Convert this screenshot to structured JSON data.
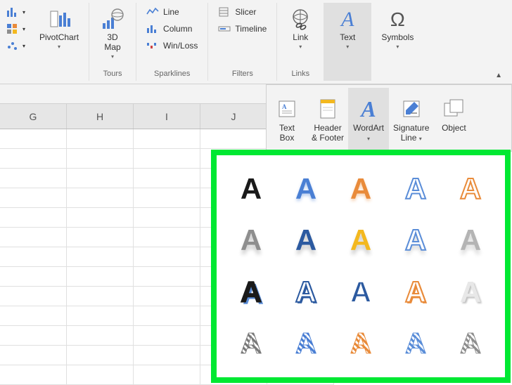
{
  "ribbon": {
    "charts": {
      "group_label": ""
    },
    "pivotchart_label": "PivotChart",
    "tours": {
      "group_label": "Tours",
      "map_label": "3D\nMap"
    },
    "sparklines": {
      "group_label": "Sparklines",
      "line": "Line",
      "column": "Column",
      "winloss": "Win/Loss"
    },
    "filters": {
      "group_label": "Filters",
      "slicer": "Slicer",
      "timeline": "Timeline"
    },
    "links": {
      "group_label": "Links",
      "link_label": "Link"
    },
    "text": {
      "group_label": "",
      "text_label": "Text"
    },
    "symbols": {
      "group_label": "",
      "symbols_label": "Symbols"
    }
  },
  "text_submenu": {
    "textbox": "Text\nBox",
    "header_footer": "Header\n& Footer",
    "wordart": "WordArt",
    "signature": "Signature\nLine",
    "object": "Object"
  },
  "columns": [
    "G",
    "H",
    "I",
    "J"
  ],
  "wordart_glyph": "A",
  "wordart_styles": [
    {
      "fill": "#1a1a1a",
      "stroke": "none",
      "shadow": "none",
      "style": "normal"
    },
    {
      "fill": "#4a7fd4",
      "stroke": "none",
      "shadow": "0 3px 4px rgba(74,127,212,.4)",
      "style": "normal"
    },
    {
      "fill": "#e98b3a",
      "stroke": "none",
      "shadow": "0 3px 4px rgba(233,139,58,.4)",
      "style": "normal"
    },
    {
      "fill": "#ffffff",
      "stroke": "#5a8dd8",
      "shadow": "none",
      "style": "outline"
    },
    {
      "fill": "#ffffff",
      "stroke": "#e98b3a",
      "shadow": "none",
      "style": "outline"
    },
    {
      "fill": "#8e8e8e",
      "stroke": "none",
      "shadow": "0 6px 6px rgba(0,0,0,.2)",
      "style": "normal"
    },
    {
      "fill": "#2c5aa0",
      "stroke": "none",
      "shadow": "0 6px 6px rgba(0,0,0,.2)",
      "style": "normal"
    },
    {
      "fill": "#f3b81f",
      "stroke": "none",
      "shadow": "0 6px 6px rgba(0,0,0,.2)",
      "style": "normal"
    },
    {
      "fill": "#ffffff",
      "stroke": "#5a8dd8",
      "shadow": "0 6px 6px rgba(0,0,0,.15)",
      "style": "outline"
    },
    {
      "fill": "#b4b4b4",
      "stroke": "none",
      "shadow": "0 6px 6px rgba(0,0,0,.15)",
      "style": "normal"
    },
    {
      "fill": "#1a1a1a",
      "stroke": "#1a1a1a",
      "shadow": "3px 3px 0 #5a8dd8",
      "style": "normal"
    },
    {
      "fill": "#ffffff",
      "stroke": "#2c5aa0",
      "shadow": "2px 2px 0 #2c5aa0",
      "style": "outline"
    },
    {
      "fill": "#2c5aa0",
      "stroke": "#ffffff",
      "shadow": "0 0 0 3px #2c5aa0",
      "style": "normal"
    },
    {
      "fill": "#ffffff",
      "stroke": "#e98b3a",
      "shadow": "2px 2px 0 #e98b3a",
      "style": "outline"
    },
    {
      "fill": "#e8e8e8",
      "stroke": "none",
      "shadow": "2px 2px 2px rgba(0,0,0,.25), -1px -1px 1px rgba(255,255,255,.9)",
      "style": "normal"
    },
    {
      "fill": "#7a7a7a",
      "stroke": "none",
      "shadow": "none",
      "style": "pattern"
    },
    {
      "fill": "#4a7fd4",
      "stroke": "none",
      "shadow": "none",
      "style": "pattern"
    },
    {
      "fill": "#e98b3a",
      "stroke": "none",
      "shadow": "none",
      "style": "pattern"
    },
    {
      "fill": "#5a8dd8",
      "stroke": "none",
      "shadow": "none",
      "style": "pattern"
    },
    {
      "fill": "#8e8e8e",
      "stroke": "none",
      "shadow": "none",
      "style": "pattern"
    }
  ]
}
